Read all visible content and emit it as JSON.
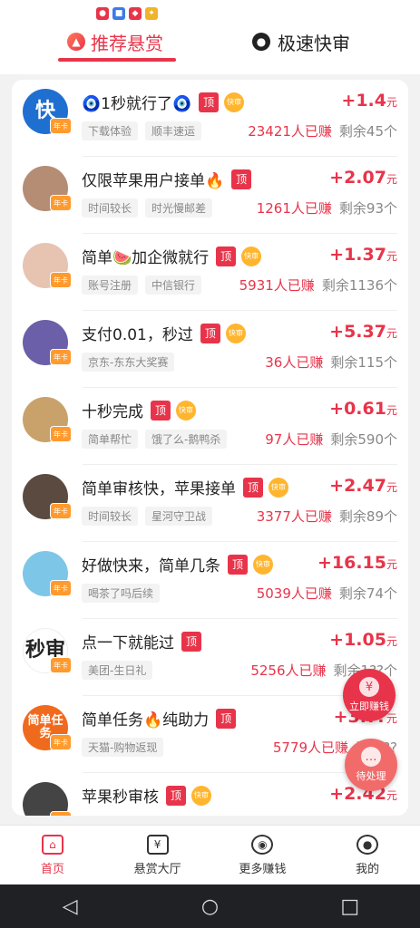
{
  "tabs": {
    "recommended": "推荐悬赏",
    "fast_review": "极速快审"
  },
  "tags": {
    "top": "顶",
    "fast": "快审"
  },
  "crown_label": "年卡",
  "currency_unit": "元",
  "rows": [
    {
      "title": "🧿1秒就行了🧿",
      "reward": "+1.4",
      "chips": [
        "下载体验",
        "顺丰速运"
      ],
      "earned": "23421人已赚",
      "remain": "剩余45个",
      "fast": true,
      "avatar_text": "快",
      "avatar_color": "#1f6fd1"
    },
    {
      "title": "仅限苹果用户接单🔥",
      "reward": "+2.07",
      "chips": [
        "时间较长",
        "时光慢邮差"
      ],
      "earned": "1261人已赚",
      "remain": "剩余93个",
      "fast": false,
      "avatar_text": "",
      "avatar_color": "#b58d74"
    },
    {
      "title": "简单🍉加企微就行",
      "reward": "+1.37",
      "chips": [
        "账号注册",
        "中信银行"
      ],
      "earned": "5931人已赚",
      "remain": "剩余1136个",
      "fast": true,
      "avatar_text": "",
      "avatar_color": "#e7c3b2"
    },
    {
      "title": "支付0.01，秒过",
      "reward": "+5.37",
      "chips": [
        "京东-东东大奖赛"
      ],
      "earned": "36人已赚",
      "remain": "剩余115个",
      "fast": true,
      "avatar_text": "",
      "avatar_color": "#6a5fa8"
    },
    {
      "title": "十秒完成",
      "reward": "+0.61",
      "chips": [
        "简单帮忙",
        "饿了么-鹅鸭杀"
      ],
      "earned": "97人已赚",
      "remain": "剩余590个",
      "fast": true,
      "avatar_text": "",
      "avatar_color": "#c9a16b"
    },
    {
      "title": "简单审核快，苹果接单",
      "reward": "+2.47",
      "chips": [
        "时间较长",
        "星河守卫战"
      ],
      "earned": "3377人已赚",
      "remain": "剩余89个",
      "fast": true,
      "avatar_text": "",
      "avatar_color": "#5a4a40"
    },
    {
      "title": "好做快来，简单几条",
      "reward": "+16.15",
      "chips": [
        "喝茶了吗后续"
      ],
      "earned": "5039人已赚",
      "remain": "剩余74个",
      "fast": true,
      "avatar_text": "",
      "avatar_color": "#7ec6e8"
    },
    {
      "title": "点一下就能过",
      "reward": "+1.05",
      "chips": [
        "美团-生日礼"
      ],
      "earned": "5256人已赚",
      "remain": "剩余1??个",
      "fast": false,
      "avatar_text": "秒审",
      "avatar_color": "#ffffff"
    },
    {
      "title": "简单任务🔥纯助力",
      "reward": "+3.??",
      "chips": [
        "天猫-购物返现"
      ],
      "earned": "5779人已赚",
      "remain": "剩余??",
      "fast": false,
      "avatar_text": "简单任务",
      "avatar_color": "#f06a1e"
    },
    {
      "title": "苹果秒审核",
      "reward": "+2.42",
      "chips": [],
      "earned": "",
      "remain": "",
      "fast": true,
      "avatar_text": "",
      "avatar_color": "#444444"
    }
  ],
  "floating": {
    "earn_now": "立即赚钱",
    "earn_symbol": "¥",
    "pending": "待处理",
    "pending_symbol": "…"
  },
  "bottom_nav": [
    {
      "label": "首页",
      "icon": "home-icon",
      "glyph": "⌂"
    },
    {
      "label": "悬赏大厅",
      "icon": "reward-hall-icon",
      "glyph": "¥"
    },
    {
      "label": "更多赚钱",
      "icon": "gamepad-icon",
      "glyph": "◉"
    },
    {
      "label": "我的",
      "icon": "user-icon",
      "glyph": "●"
    }
  ],
  "system_nav": {
    "back": "◁",
    "home": "○",
    "recent": "□"
  },
  "colors": {
    "accent": "#e8344a",
    "fast_badge": "#ffb52e",
    "crown": "#ff9a2e"
  }
}
